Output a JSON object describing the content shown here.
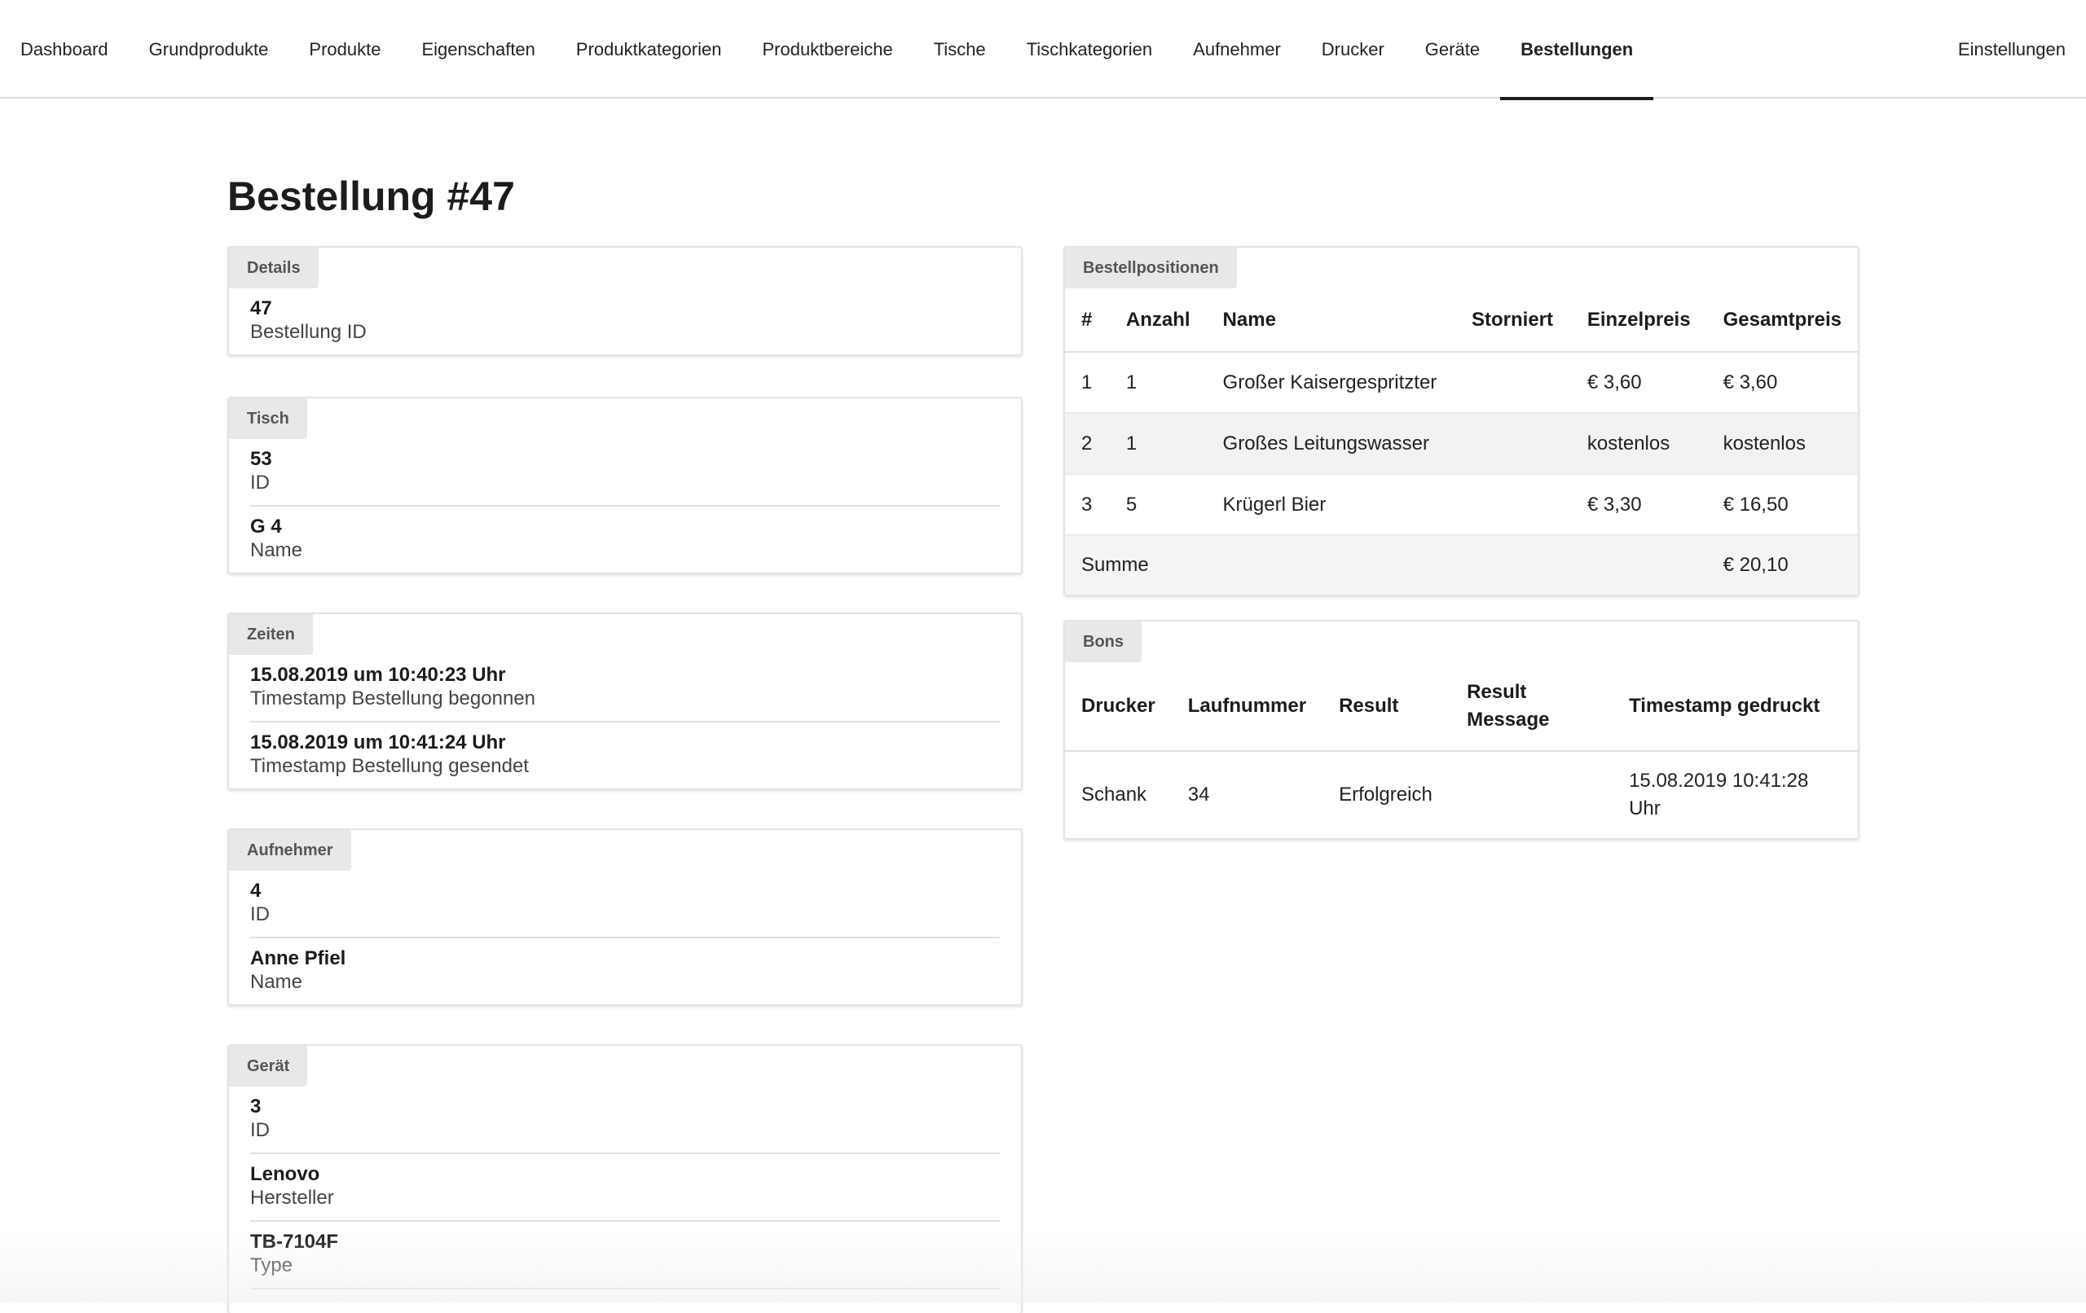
{
  "nav": {
    "items": [
      {
        "label": "Dashboard"
      },
      {
        "label": "Grundprodukte"
      },
      {
        "label": "Produkte"
      },
      {
        "label": "Eigenschaften"
      },
      {
        "label": "Produktkategorien"
      },
      {
        "label": "Produktbereiche"
      },
      {
        "label": "Tische"
      },
      {
        "label": "Tischkategorien"
      },
      {
        "label": "Aufnehmer"
      },
      {
        "label": "Drucker"
      },
      {
        "label": "Geräte"
      },
      {
        "label": "Bestellungen"
      }
    ],
    "active": "Bestellungen",
    "settings": "Einstellungen"
  },
  "page": {
    "title": "Bestellung #47"
  },
  "details": {
    "tag": "Details",
    "fields": [
      {
        "value": "47",
        "label": "Bestellung ID"
      }
    ]
  },
  "tisch": {
    "tag": "Tisch",
    "fields": [
      {
        "value": "53",
        "label": "ID"
      },
      {
        "value": "G 4",
        "label": "Name"
      }
    ]
  },
  "zeiten": {
    "tag": "Zeiten",
    "fields": [
      {
        "value": "15.08.2019 um 10:40:23 Uhr",
        "label": "Timestamp Bestellung begonnen"
      },
      {
        "value": "15.08.2019 um 10:41:24 Uhr",
        "label": "Timestamp Bestellung gesendet"
      }
    ]
  },
  "aufnehmer": {
    "tag": "Aufnehmer",
    "fields": [
      {
        "value": "4",
        "label": "ID"
      },
      {
        "value": "Anne Pfiel",
        "label": "Name"
      }
    ]
  },
  "geraet": {
    "tag": "Gerät",
    "fields": [
      {
        "value": "3",
        "label": "ID"
      },
      {
        "value": "Lenovo",
        "label": "Hersteller"
      },
      {
        "value": "TB-7104F",
        "label": "Type"
      }
    ]
  },
  "positionen": {
    "tag": "Bestellpositionen",
    "headers": [
      "#",
      "Anzahl",
      "Name",
      "Storniert",
      "Einzelpreis",
      "Gesamtpreis"
    ],
    "rows": [
      [
        "1",
        "1",
        "Großer Kaisergespritzter",
        "",
        "€ 3,60",
        "€ 3,60"
      ],
      [
        "2",
        "1",
        "Großes Leitungswasser",
        "",
        "kostenlos",
        "kostenlos"
      ],
      [
        "3",
        "5",
        "Krügerl Bier",
        "",
        "€ 3,30",
        "€ 16,50"
      ]
    ],
    "sum_label": "Summe",
    "sum_value": "€ 20,10"
  },
  "bons": {
    "tag": "Bons",
    "headers": [
      "Drucker",
      "Laufnummer",
      "Result",
      "Result Message",
      "Timestamp gedruckt"
    ],
    "rows": [
      [
        "Schank",
        "34",
        "Erfolgreich",
        "",
        "15.08.2019 10:41:28 Uhr"
      ]
    ]
  }
}
